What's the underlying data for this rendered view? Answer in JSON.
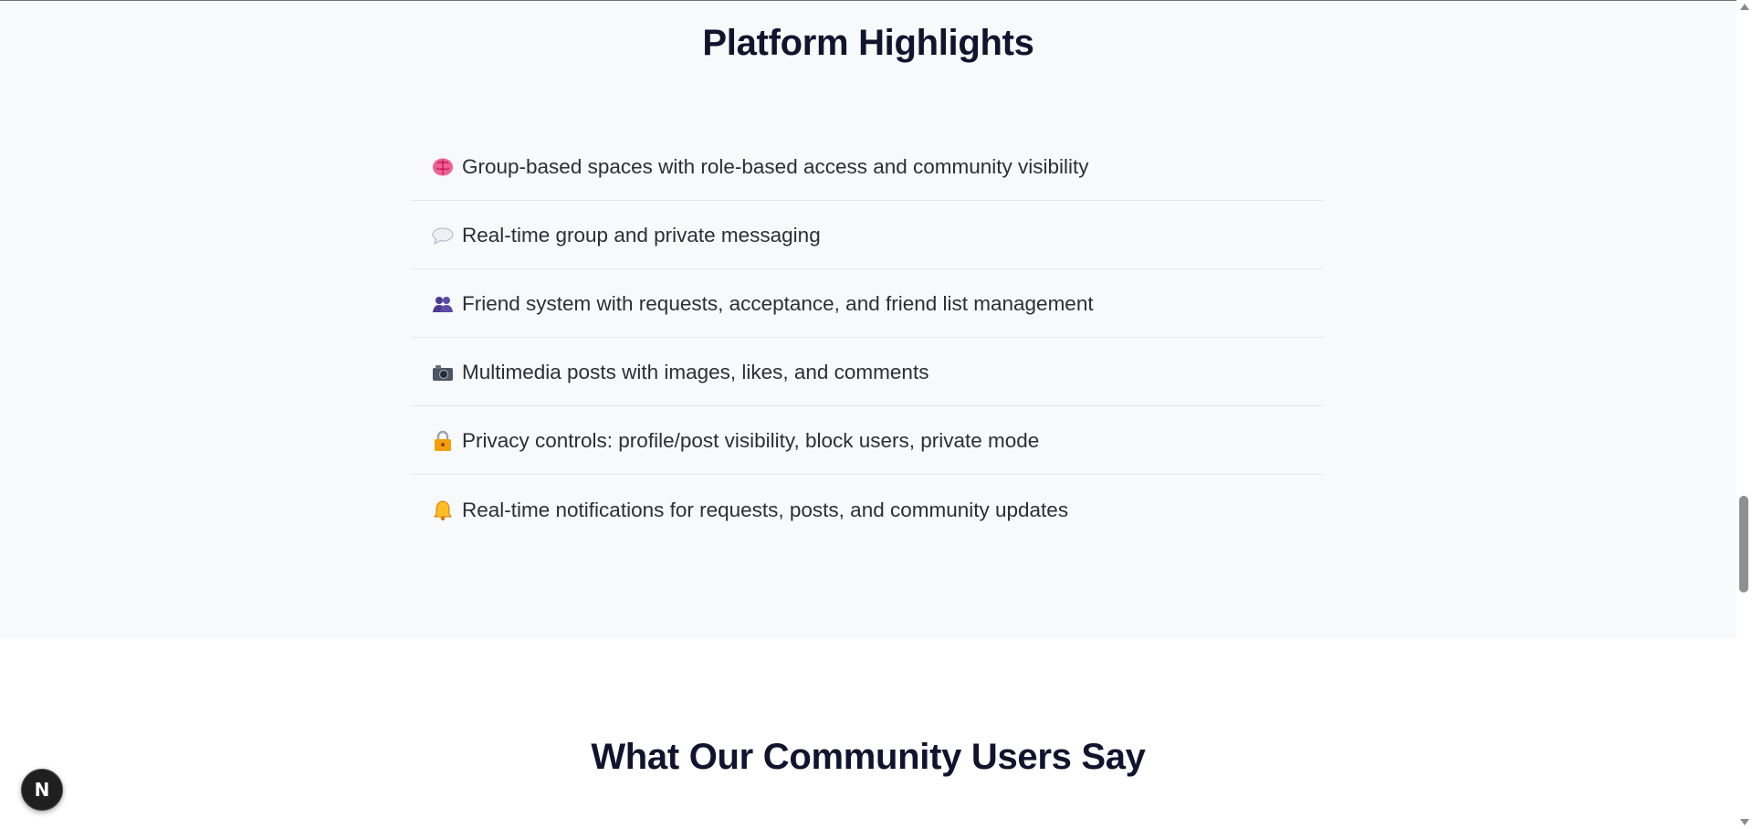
{
  "highlights": {
    "title": "Platform Highlights",
    "items": [
      {
        "icon": "brain-icon",
        "text": "Group-based spaces with role-based access and community visibility"
      },
      {
        "icon": "speech-bubble-icon",
        "text": "Real-time group and private messaging"
      },
      {
        "icon": "people-icon",
        "text": "Friend system with requests, acceptance, and friend list management"
      },
      {
        "icon": "camera-icon",
        "text": "Multimedia posts with images, likes, and comments"
      },
      {
        "icon": "lock-icon",
        "text": "Privacy controls: profile/post visibility, block users, private mode"
      },
      {
        "icon": "bell-icon",
        "text": "Real-time notifications for requests, posts, and community updates"
      }
    ]
  },
  "testimonials": {
    "title": "What Our Community Users Say"
  },
  "dev_badge": {
    "label": "N"
  },
  "colors": {
    "section_background": "#f8f9fb",
    "heading": "#11142d",
    "divider": "#e5e7eb"
  }
}
